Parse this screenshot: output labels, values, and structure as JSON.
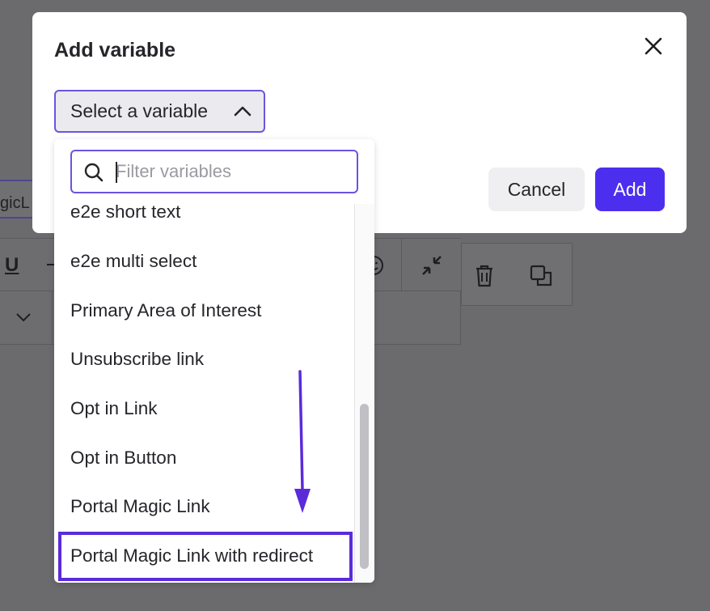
{
  "background": {
    "input_fragment": "gicL",
    "toolbar": {
      "underline_label": "U"
    }
  },
  "modal": {
    "title": "Add variable",
    "select_label": "Select a variable",
    "cancel_label": "Cancel",
    "add_label": "Add"
  },
  "dropdown": {
    "filter_placeholder": "Filter variables",
    "filter_value": "",
    "items": [
      {
        "label": "e2e short text"
      },
      {
        "label": "e2e multi select"
      },
      {
        "label": "Primary Area of Interest"
      },
      {
        "label": "Unsubscribe link"
      },
      {
        "label": "Opt in Link"
      },
      {
        "label": "Opt in Button"
      },
      {
        "label": "Portal Magic Link"
      },
      {
        "label": "Portal Magic Link with redirect",
        "highlighted": true
      }
    ]
  },
  "colors": {
    "accent": "#4c2fee",
    "focus_border": "#6a55e0",
    "annotation": "#5b2bd9",
    "overlay": "#6b6b6e"
  },
  "icons": {
    "close": "close-icon",
    "chevron": "chevron-up-icon",
    "search": "search-icon",
    "emoji": "emoji-icon",
    "collapse": "collapse-icon",
    "trash": "trash-icon",
    "duplicate": "duplicate-icon",
    "dropdown_chevron": "chevron-down-icon"
  }
}
